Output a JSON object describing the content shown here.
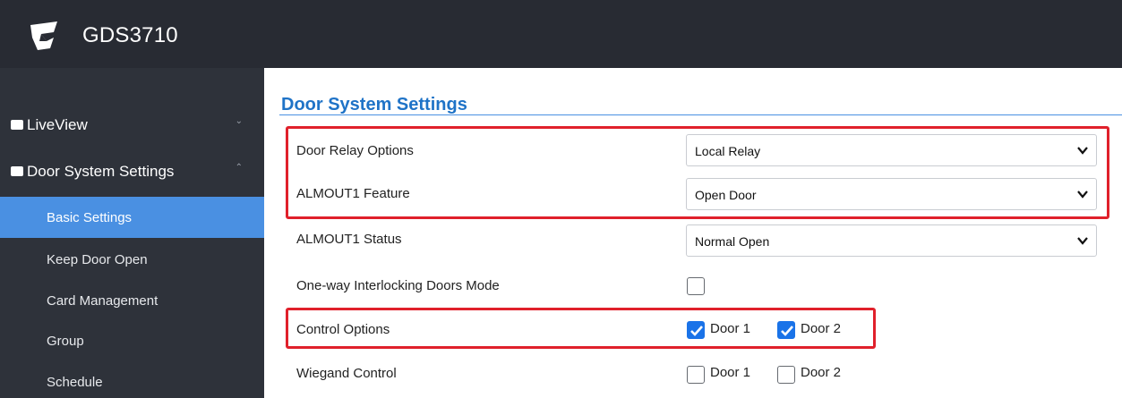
{
  "app": {
    "title": "GDS3710"
  },
  "sidebar": {
    "items": [
      {
        "label": "LiveView",
        "chevron": "⌄"
      },
      {
        "label": "Door System Settings",
        "chevron": "⌃"
      }
    ],
    "subitems": [
      {
        "label": "Basic Settings",
        "active": true
      },
      {
        "label": "Keep Door Open",
        "active": false
      },
      {
        "label": "Card Management",
        "active": false
      },
      {
        "label": "Group",
        "active": false
      },
      {
        "label": "Schedule",
        "active": false
      }
    ]
  },
  "page": {
    "title": "Door System Settings"
  },
  "fields": {
    "door_relay_options": {
      "label": "Door Relay Options",
      "value": "Local Relay"
    },
    "almout1_feature": {
      "label": "ALMOUT1 Feature",
      "value": "Open Door"
    },
    "almout1_status": {
      "label": "ALMOUT1 Status",
      "value": "Normal Open"
    },
    "one_way_interlocking": {
      "label": "One-way Interlocking Doors Mode",
      "checked": false
    },
    "control_options": {
      "label": "Control Options",
      "door1": "Door 1",
      "door2": "Door 2",
      "door1_checked": true,
      "door2_checked": true
    },
    "wiegand_control": {
      "label": "Wiegand Control",
      "door1": "Door 1",
      "door2": "Door 2",
      "door1_checked": false,
      "door2_checked": false
    }
  },
  "colors": {
    "header_bg": "#282b33",
    "sidebar_bg": "#2e323a",
    "active_item": "#4a90e2",
    "title_blue": "#1f73c7",
    "highlight_red": "#e0202b",
    "checkbox_blue": "#1a73e8"
  },
  "icons": {
    "logo": "grandstream-logo-icon",
    "liveview": "video-play-icon",
    "door_settings": "card-icon",
    "select_arrow": "chevron-down-icon",
    "check": "checkmark-icon"
  }
}
